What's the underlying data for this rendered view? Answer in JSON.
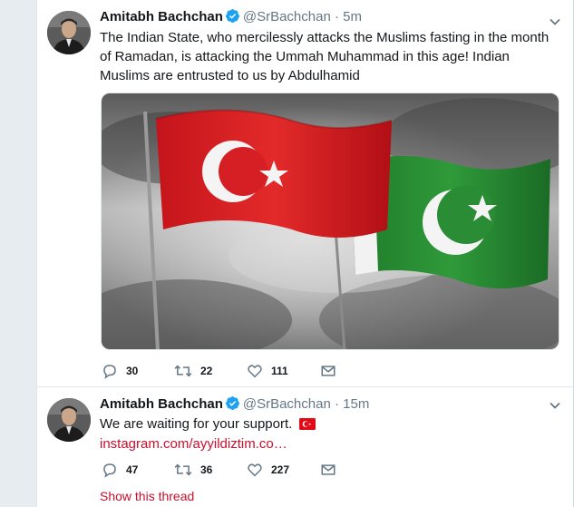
{
  "accent_color": "#c8102e",
  "tweets": [
    {
      "name": "Amitabh Bachchan",
      "handle": "@SrBachchan",
      "dot": "·",
      "time": "5m",
      "text": "The Indian State, who mercilessly attacks the Muslims fasting in the month of Ramadan, is attacking the Ummah Muhammad in this age! Indian Muslims are entrusted to us by Abdulhamid",
      "media_icon": "flags-photo",
      "reply_count": "30",
      "retweet_count": "22",
      "like_count": "111"
    },
    {
      "name": "Amitabh Bachchan",
      "handle": "@SrBachchan",
      "dot": "·",
      "time": "15m",
      "text": "We are waiting for your support.",
      "emoji_icon": "turkey-flag-emoji",
      "link": "instagram.com/ayyildiztim.co…",
      "reply_count": "47",
      "retweet_count": "36",
      "like_count": "227",
      "show_thread": "Show this thread"
    }
  ]
}
